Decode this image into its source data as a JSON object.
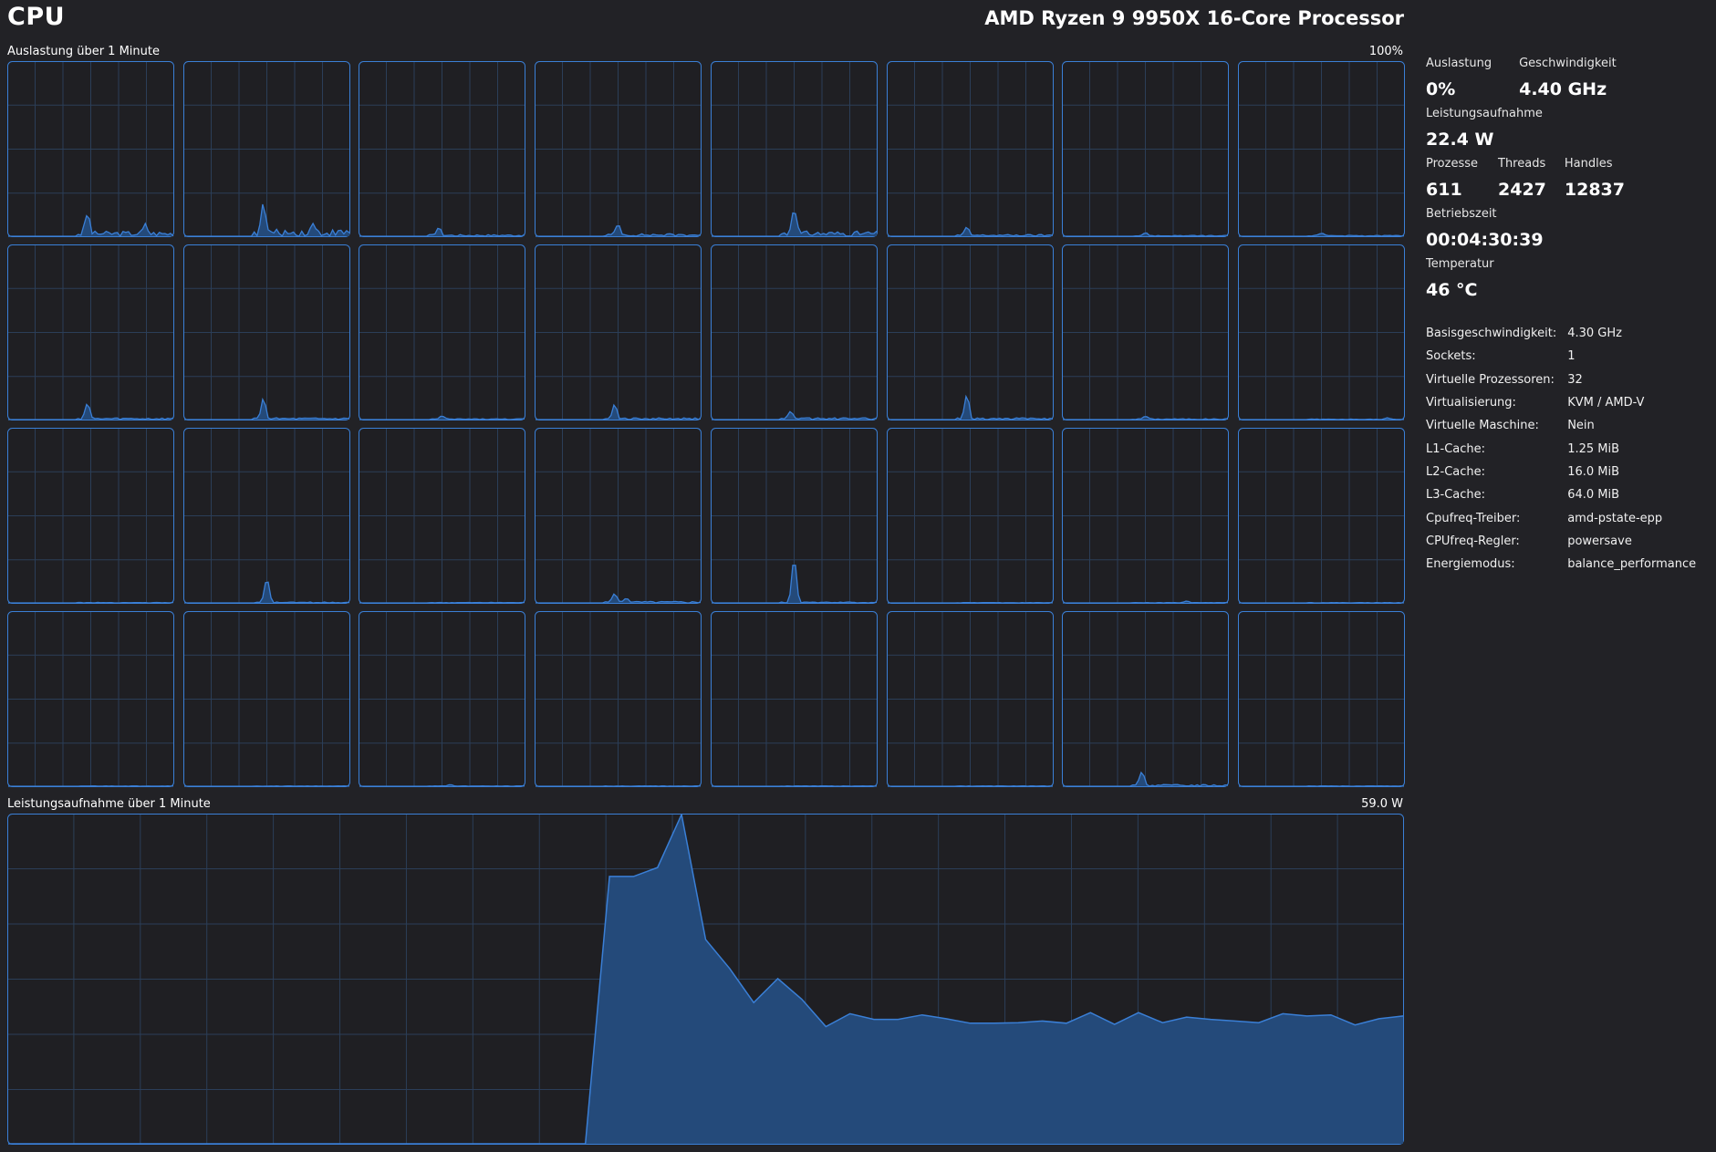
{
  "header": {
    "title": "CPU",
    "model": "AMD Ryzen 9 9950X 16-Core Processor"
  },
  "utilization_graph": {
    "label": "Auslastung über 1 Minute",
    "max_label": "100%",
    "cores": [
      {
        "peaks": [
          [
            0.48,
            0.13
          ],
          [
            0.83,
            0.05
          ]
        ],
        "noise": 0.03
      },
      {
        "peaks": [
          [
            0.48,
            0.18
          ],
          [
            0.78,
            0.05
          ]
        ],
        "noise": 0.04
      },
      {
        "peaks": [
          [
            0.48,
            0.05
          ]
        ],
        "noise": 0.01
      },
      {
        "peaks": [
          [
            0.5,
            0.07
          ]
        ],
        "noise": 0.015
      },
      {
        "peaks": [
          [
            0.5,
            0.18
          ]
        ],
        "noise": 0.03
      },
      {
        "peaks": [
          [
            0.48,
            0.05
          ]
        ],
        "noise": 0.01
      },
      {
        "peaks": [
          [
            0.5,
            0.02
          ]
        ],
        "noise": 0.005
      },
      {
        "peaks": [
          [
            0.5,
            0.02
          ]
        ],
        "noise": 0.005
      },
      {
        "peaks": [
          [
            0.48,
            0.1
          ]
        ],
        "noise": 0.01
      },
      {
        "peaks": [
          [
            0.48,
            0.13
          ]
        ],
        "noise": 0.01
      },
      {
        "peaks": [
          [
            0.5,
            0.02
          ]
        ],
        "noise": 0.005
      },
      {
        "peaks": [
          [
            0.48,
            0.09
          ]
        ],
        "noise": 0.01
      },
      {
        "peaks": [
          [
            0.48,
            0.05
          ]
        ],
        "noise": 0.01
      },
      {
        "peaks": [
          [
            0.48,
            0.15
          ]
        ],
        "noise": 0.01
      },
      {
        "peaks": [
          [
            0.5,
            0.02
          ]
        ],
        "noise": 0.005
      },
      {
        "peaks": [
          [
            0.9,
            0.01
          ]
        ],
        "noise": 0.003
      },
      {
        "peaks": [],
        "noise": 0.003
      },
      {
        "peaks": [
          [
            0.5,
            0.16
          ]
        ],
        "noise": 0.005
      },
      {
        "peaks": [],
        "noise": 0.003
      },
      {
        "peaks": [
          [
            0.48,
            0.05
          ],
          [
            0.55,
            0.03
          ]
        ],
        "noise": 0.01
      },
      {
        "peaks": [
          [
            0.5,
            0.3
          ]
        ],
        "noise": 0.005
      },
      {
        "peaks": [],
        "noise": 0.002
      },
      {
        "peaks": [
          [
            0.75,
            0.01
          ]
        ],
        "noise": 0.002
      },
      {
        "peaks": [],
        "noise": 0.002
      },
      {
        "peaks": [],
        "noise": 0.002
      },
      {
        "peaks": [],
        "noise": 0.002
      },
      {
        "peaks": [
          [
            0.55,
            0.01
          ]
        ],
        "noise": 0.002
      },
      {
        "peaks": [],
        "noise": 0.002
      },
      {
        "peaks": [],
        "noise": 0.002
      },
      {
        "peaks": [],
        "noise": 0.002
      },
      {
        "peaks": [
          [
            0.48,
            0.09
          ]
        ],
        "noise": 0.01
      },
      {
        "peaks": [],
        "noise": 0.002
      }
    ]
  },
  "power_graph": {
    "label": "Leistungsaufnahme über 1 Minute",
    "max_label": "59.0 W",
    "max_value": 59.0,
    "samples": [
      0,
      0,
      0,
      0,
      0,
      0,
      0,
      0,
      0,
      0,
      0,
      0,
      0,
      0,
      0,
      0,
      0,
      0,
      0,
      0,
      0,
      0,
      0,
      0,
      0,
      47.9,
      47.9,
      49.5,
      59.0,
      36.6,
      31.4,
      25.3,
      29.6,
      25.9,
      21.0,
      23.3,
      22.3,
      22.3,
      23.1,
      22.4,
      21.6,
      21.6,
      21.7,
      22.0,
      21.6,
      23.5,
      21.4,
      23.5,
      21.7,
      22.7,
      22.3,
      22.0,
      21.7,
      23.3,
      22.9,
      23.1,
      21.3,
      22.4,
      22.9
    ]
  },
  "colors": {
    "background": "#222226",
    "graph_line": "#3a7fd6",
    "graph_fill": "#244a7a",
    "grid": "#2b3e58"
  },
  "stats": {
    "utilization": {
      "label": "Auslastung",
      "value": "0%"
    },
    "speed": {
      "label": "Geschwindigkeit",
      "value": "4.40 GHz"
    },
    "power": {
      "label": "Leistungsaufnahme",
      "value": "22.4 W"
    },
    "processes": {
      "label": "Prozesse",
      "value": "611"
    },
    "threads": {
      "label": "Threads",
      "value": "2427"
    },
    "handles": {
      "label": "Handles",
      "value": "12837"
    },
    "uptime": {
      "label": "Betriebszeit",
      "value": "00:04:30:39"
    },
    "temperature": {
      "label": "Temperatur",
      "value": "46 °C"
    }
  },
  "info": [
    {
      "key": "Basisgeschwindigkeit:",
      "value": "4.30 GHz"
    },
    {
      "key": "Sockets:",
      "value": "1"
    },
    {
      "key": "Virtuelle Prozessoren:",
      "value": "32"
    },
    {
      "key": "Virtualisierung:",
      "value": "KVM / AMD-V"
    },
    {
      "key": "Virtuelle Maschine:",
      "value": "Nein"
    },
    {
      "key": "L1-Cache:",
      "value": "1.25 MiB"
    },
    {
      "key": "L2-Cache:",
      "value": "16.0 MiB"
    },
    {
      "key": "L3-Cache:",
      "value": "64.0 MiB"
    },
    {
      "key": "Cpufreq-Treiber:",
      "value": "amd-pstate-epp"
    },
    {
      "key": "CPUfreq-Regler:",
      "value": "powersave"
    },
    {
      "key": "Energiemodus:",
      "value": "balance_performance"
    }
  ]
}
